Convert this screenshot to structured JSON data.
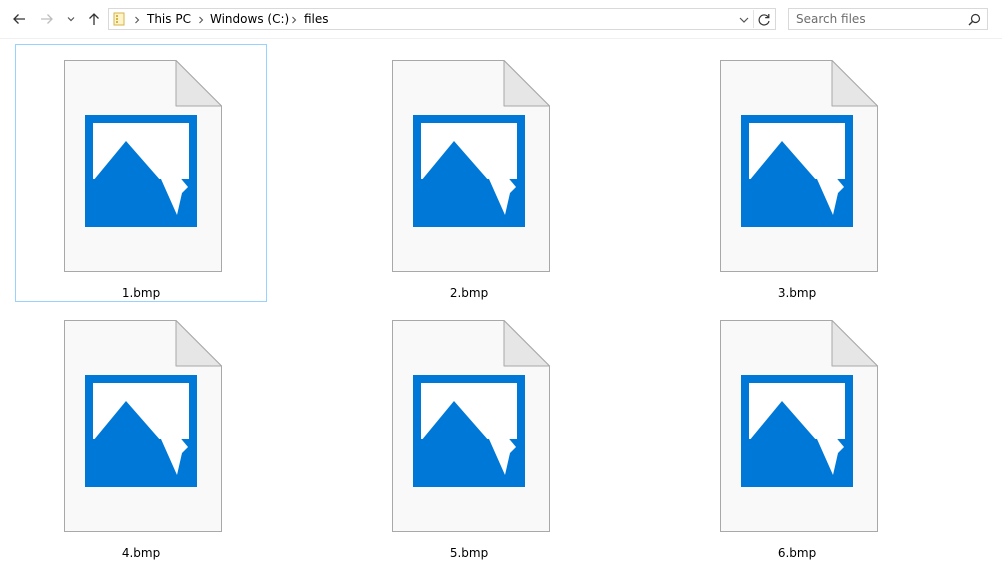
{
  "toolbar": {
    "breadcrumb": [
      {
        "label": "This PC"
      },
      {
        "label": "Windows (C:)"
      },
      {
        "label": "files"
      }
    ],
    "search_placeholder": "Search files"
  },
  "files": [
    {
      "name": "1.bmp",
      "selected": true
    },
    {
      "name": "2.bmp",
      "selected": false
    },
    {
      "name": "3.bmp",
      "selected": false
    },
    {
      "name": "4.bmp",
      "selected": false
    },
    {
      "name": "5.bmp",
      "selected": false
    },
    {
      "name": "6.bmp",
      "selected": false
    }
  ],
  "colors": {
    "accent": "#0078d7",
    "selection_border": "#99d1ff",
    "page": "#f9f9f9",
    "page_border": "#a8a8a8"
  },
  "icons": [
    "back-arrow-icon",
    "forward-arrow-icon",
    "chevron-down-icon",
    "up-arrow-icon",
    "folder-icon",
    "chevron-right-icon",
    "refresh-icon",
    "search-icon",
    "bitmap-image-icon"
  ]
}
